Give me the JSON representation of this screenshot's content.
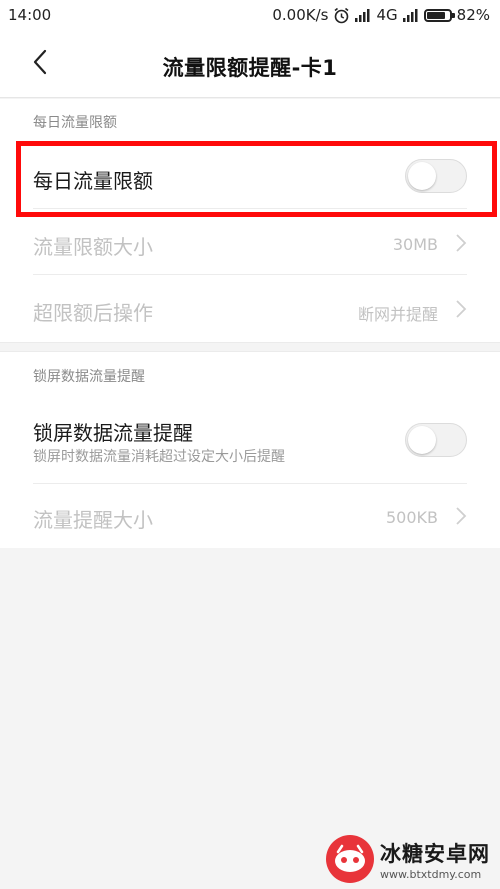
{
  "status_bar": {
    "time": "14:00",
    "net_speed": "0.00K/s",
    "network": "4G",
    "battery_percent": "82%",
    "battery_level": 0.82,
    "icons": [
      "alarm-icon",
      "signal-icon",
      "signal-icon",
      "battery-icon"
    ]
  },
  "header": {
    "title": "流量限额提醒-卡1",
    "back_icon": "chevron-left-icon"
  },
  "sections": [
    {
      "header": "每日流量限额",
      "rows": [
        {
          "label": "每日流量限额",
          "type": "toggle",
          "on": false,
          "highlighted": true
        },
        {
          "label": "流量限额大小",
          "value": "30MB",
          "type": "link",
          "disabled": true
        },
        {
          "label": "超限额后操作",
          "value": "断网并提醒",
          "type": "link",
          "disabled": true
        }
      ]
    },
    {
      "header": "锁屏数据流量提醒",
      "rows": [
        {
          "label": "锁屏数据流量提醒",
          "sub": "锁屏时数据流量消耗超过设定大小后提醒",
          "type": "toggle",
          "on": false
        },
        {
          "label": "流量提醒大小",
          "value": "500KB",
          "type": "link",
          "disabled": true
        }
      ]
    }
  ],
  "colors": {
    "highlight": "#ff0a0a",
    "watermark_red": "#e8343a"
  },
  "watermark": {
    "title": "冰糖安卓网",
    "url": "www.btxtdmy.com"
  }
}
